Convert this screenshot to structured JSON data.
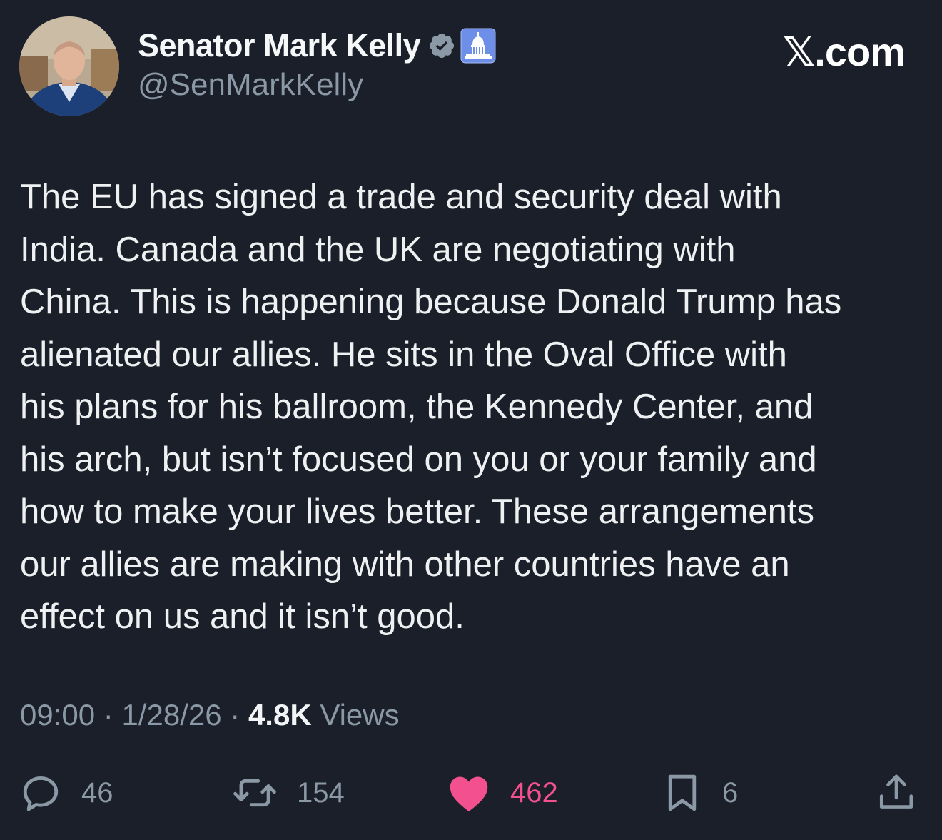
{
  "author": {
    "display_name": "Senator Mark Kelly",
    "handle": "@SenMarkKelly",
    "verified_icon": "verified-check-icon",
    "affiliation_icon": "capitol-dome-icon"
  },
  "brand": "𝕏.com",
  "tweet": {
    "text": "The EU has signed a trade and security deal with\nIndia. Canada and the UK are negotiating with\nChina. This is happening because Donald Trump has\nalienated our allies. He sits in the Oval Office with\nhis plans for his ballroom, the Kennedy Center, and\nhis arch, but isn’t focused on you or your family and\nhow to make your lives better. These arrangements\nour allies are making with other countries have an\neffect on us and it isn’t good."
  },
  "meta": {
    "time": "09:00",
    "separator": "·",
    "date": "1/28/26",
    "views_count": "4.8K",
    "views_label": "Views"
  },
  "actions": {
    "replies": "46",
    "reposts": "154",
    "likes": "462",
    "bookmarks": "6"
  },
  "colors": {
    "background": "#1a1f29",
    "text": "#eef0f1",
    "muted": "#8b98a5",
    "like": "#f2508f",
    "verified": "#8b98a5"
  }
}
